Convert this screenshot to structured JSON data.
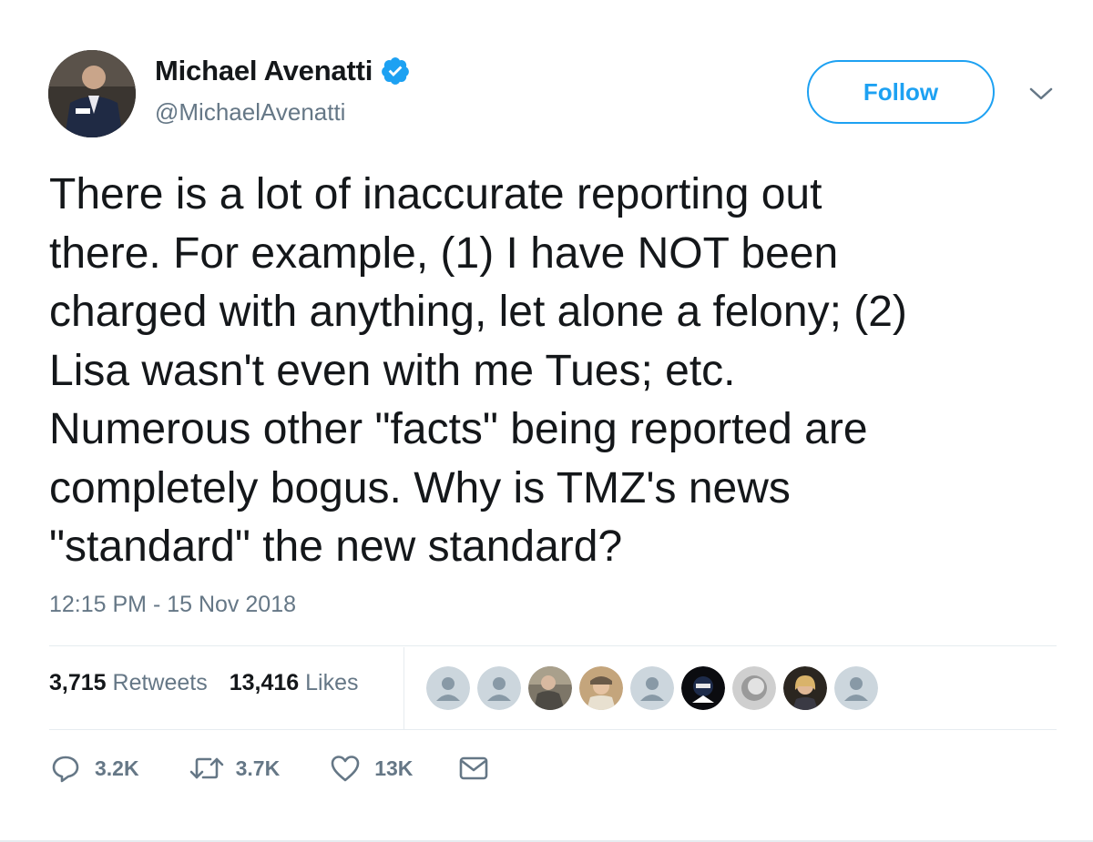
{
  "author": {
    "name": "Michael Avenatti",
    "handle": "@MichaelAvenatti",
    "verified": true
  },
  "follow_button": "Follow",
  "tweet": {
    "lines": [
      "There is a lot of inaccurate reporting out",
      "there. For example, (1) I have NOT been",
      "charged with anything, let alone a felony; (2)",
      "Lisa wasn't even with me Tues; etc.",
      "Numerous other \"facts\" being reported are",
      "completely bogus. Why is TMZ's news",
      "\"standard\" the new standard?"
    ],
    "timestamp": "12:15 PM - 15 Nov 2018"
  },
  "stats": {
    "retweets_count": "3,715",
    "retweets_label": "Retweets",
    "likes_count": "13,416",
    "likes_label": "Likes"
  },
  "liker_avatars": [
    "default",
    "default",
    "photo",
    "photo",
    "default",
    "photo",
    "photo",
    "photo",
    "default"
  ],
  "actions": {
    "reply_count": "3.2K",
    "retweet_count": "3.7K",
    "like_count": "13K"
  },
  "colors": {
    "accent": "#1da1f2",
    "secondary_text": "#657786",
    "primary_text": "#14171a",
    "divider": "#e6ecf0"
  }
}
